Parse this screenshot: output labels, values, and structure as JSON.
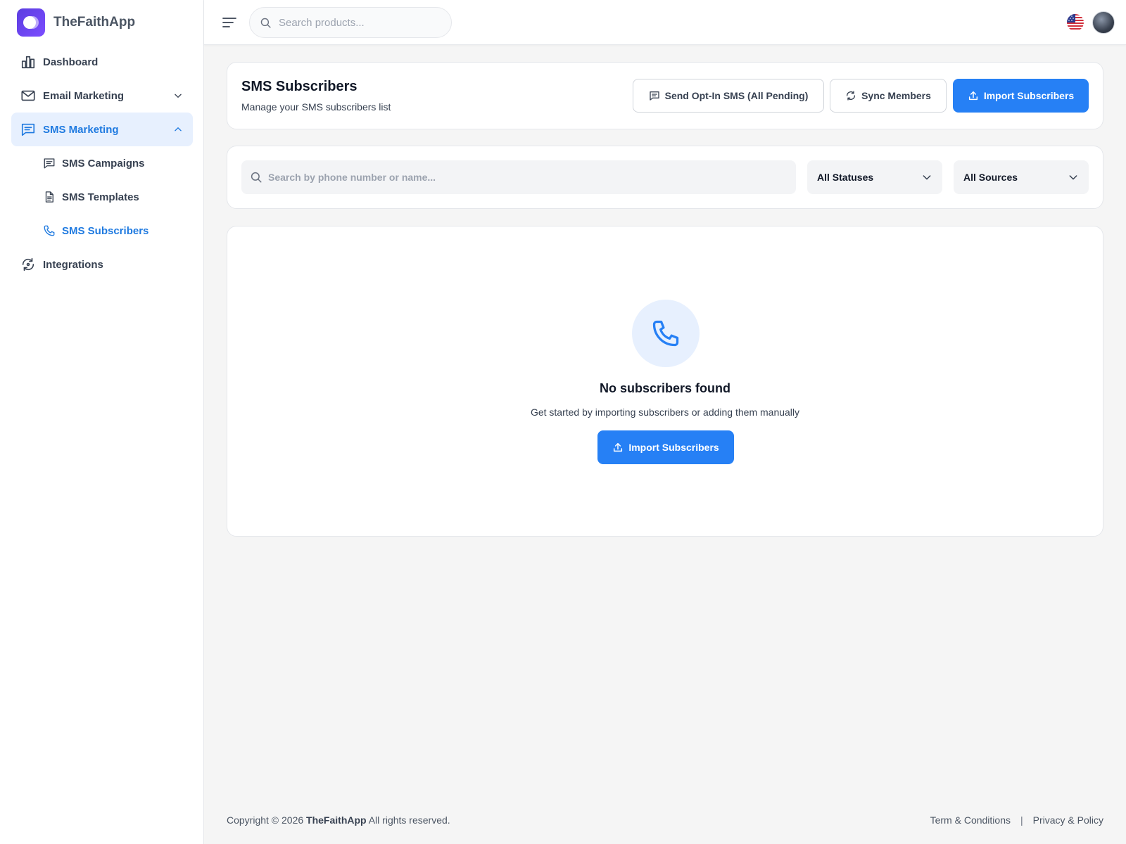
{
  "app": {
    "name": "TheFaithApp"
  },
  "sidebar": {
    "items": [
      {
        "label": "Dashboard",
        "icon": "chart-bar-icon"
      },
      {
        "label": "Email Marketing",
        "icon": "mail-icon"
      },
      {
        "label": "SMS Marketing",
        "icon": "message-square-icon",
        "active": true
      },
      {
        "label": "SMS Campaigns",
        "icon": "message-icon"
      },
      {
        "label": "SMS Templates",
        "icon": "file-text-icon"
      },
      {
        "label": "SMS Subscribers",
        "icon": "phone-icon",
        "active": true
      },
      {
        "label": "Integrations",
        "icon": "refresh-icon"
      }
    ]
  },
  "topbar": {
    "search_placeholder": "Search products..."
  },
  "header": {
    "title": "SMS Subscribers",
    "subtitle": "Manage your SMS subscribers list",
    "buttons": {
      "optin": "Send Opt-In SMS (All Pending)",
      "sync": "Sync Members",
      "import": "Import Subscribers"
    }
  },
  "filters": {
    "search_placeholder": "Search by phone number or name...",
    "status": "All Statuses",
    "source": "All Sources"
  },
  "empty": {
    "title": "No subscribers found",
    "subtitle": "Get started by importing subscribers or adding them manually",
    "button": "Import Subscribers"
  },
  "footer": {
    "prefix": "Copyright © 2026",
    "brand": "TheFaithApp",
    "suffix": "All rights reserved.",
    "terms": "Term & Conditions",
    "separator": "|",
    "privacy": "Privacy & Policy"
  },
  "colors": {
    "accent": "#2680f5",
    "active_bg": "#e7f0fe",
    "active_text": "#1f7ae0",
    "logo": "#6c45e8"
  }
}
